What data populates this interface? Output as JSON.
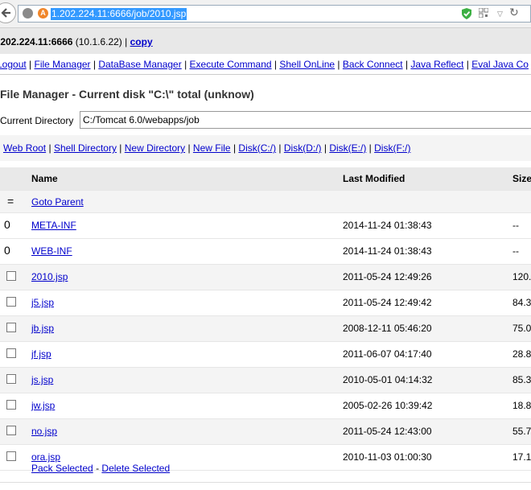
{
  "browser": {
    "url": "1.202.224.11:6666/job/2010.jsp"
  },
  "host": {
    "address": ".202.224.11:6666",
    "ip": "(10.1.6.22)",
    "sep": "|",
    "copy": "copy"
  },
  "topnav": [
    "Logout",
    "File Manager",
    "DataBase Manager",
    "Execute Command",
    "Shell OnLine",
    "Back Connect",
    "Java Reflect",
    "Eval Java Co"
  ],
  "title": "File Manager - Current disk \"C:\\\" total (unknow)",
  "current_dir": {
    "label": "Current Directory",
    "value": "C:/Tomcat 6.0/webapps/job"
  },
  "quicknav": [
    "Web Root",
    "Shell Directory",
    "New Directory",
    "New File",
    "Disk(C:/)",
    "Disk(D:/)",
    "Disk(E:/)",
    "Disk(F:/)"
  ],
  "table": {
    "headers": {
      "name": "Name",
      "modified": "Last Modified",
      "size": "Size"
    },
    "parent": {
      "marker": "=",
      "label": "Goto Parent"
    },
    "dirs": [
      {
        "marker": "0",
        "name": "META-INF",
        "modified": "2014-11-24 01:38:43",
        "size": "--"
      },
      {
        "marker": "0",
        "name": "WEB-INF",
        "modified": "2014-11-24 01:38:43",
        "size": "--"
      }
    ],
    "files": [
      {
        "name": "2010.jsp",
        "modified": "2011-05-24 12:49:26",
        "size": "120."
      },
      {
        "name": "j5.jsp",
        "modified": "2011-05-24 12:49:42",
        "size": "84.3"
      },
      {
        "name": "jb.jsp",
        "modified": "2008-12-11 05:46:20",
        "size": "75.0"
      },
      {
        "name": "jf.jsp",
        "modified": "2011-06-07 04:17:40",
        "size": "28.8"
      },
      {
        "name": "js.jsp",
        "modified": "2010-05-01 04:14:32",
        "size": "85.3"
      },
      {
        "name": "jw.jsp",
        "modified": "2005-02-26 10:39:42",
        "size": "18.8"
      },
      {
        "name": "no.jsp",
        "modified": "2011-05-24 12:43:00",
        "size": "55.7"
      },
      {
        "name": "ora.jsp",
        "modified": "2010-11-03 01:00:30",
        "size": "17.1"
      }
    ]
  },
  "footer": {
    "pack": "Pack Selected",
    "sep": "-",
    "delete": "Delete Selected"
  }
}
